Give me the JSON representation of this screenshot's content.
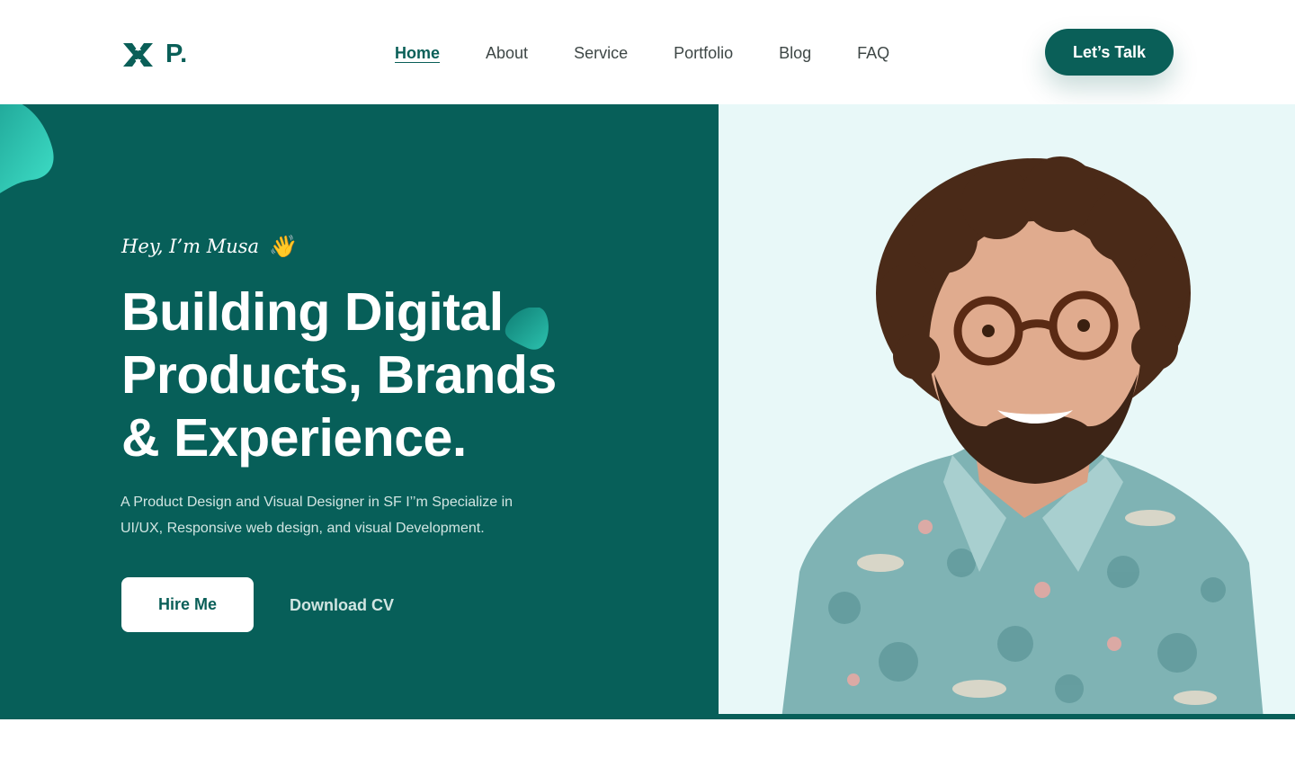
{
  "header": {
    "logo_text": "P.",
    "nav": [
      {
        "label": "Home",
        "active": true
      },
      {
        "label": "About",
        "active": false
      },
      {
        "label": "Service",
        "active": false
      },
      {
        "label": "Portfolio",
        "active": false
      },
      {
        "label": "Blog",
        "active": false
      },
      {
        "label": "FAQ",
        "active": false
      }
    ],
    "cta_label": "Let’s Talk"
  },
  "hero": {
    "greeting": "Hey, I’m Musa",
    "greeting_icon": "waving-hand-icon",
    "headline": [
      "Building Digital",
      "Products, Brands",
      "& Experience."
    ],
    "subtext": "A Product Design and Visual Designer in SF I’’m Specialize in UI/UX, Responsive web design, and visual Development.",
    "primary_button": "Hire Me",
    "secondary_link": "Download CV",
    "portrait_icon": "portrait-photo"
  },
  "colors": {
    "brand": "#075f59",
    "accent_light": "#e8f8f8",
    "blob": "#2ec4b0",
    "white": "#ffffff"
  }
}
